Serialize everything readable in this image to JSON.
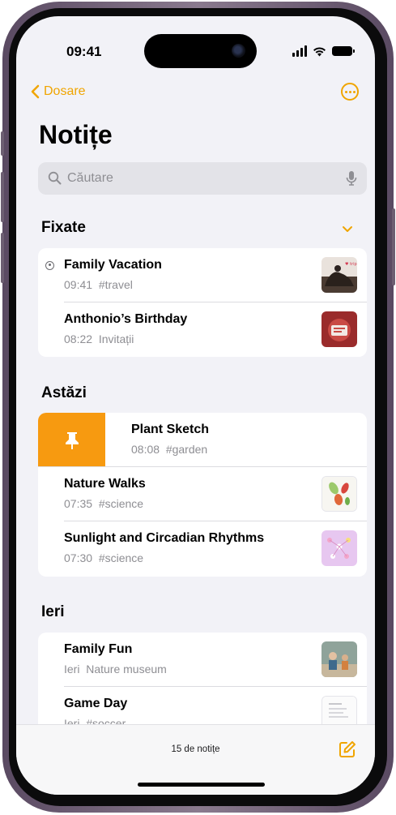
{
  "status": {
    "time": "09:41"
  },
  "nav": {
    "back_label": "Dosare"
  },
  "page": {
    "title": "Notițe"
  },
  "search": {
    "placeholder": "Căutare"
  },
  "sections": {
    "pinned": {
      "title": "Fixate"
    },
    "today": {
      "title": "Astăzi"
    },
    "yesterday": {
      "title": "Ieri"
    }
  },
  "pinned_notes": [
    {
      "title": "Family Vacation",
      "time": "09:41",
      "detail": "#travel",
      "shared": true,
      "thumb": "photo-vacation"
    },
    {
      "title": "Anthonio’s Birthday",
      "time": "08:22",
      "detail": "Invitații",
      "thumb": "photo-birthday"
    }
  ],
  "today_notes": [
    {
      "title": "Plant Sketch",
      "time": "08:08",
      "detail": "#garden",
      "swipe_action": "pin-icon"
    },
    {
      "title": "Nature Walks",
      "time": "07:35",
      "detail": "#science",
      "thumb": "sketch-leaves"
    },
    {
      "title": "Sunlight and Circadian Rhythms",
      "time": "07:30",
      "detail": "#science",
      "thumb": "sketch-flowers"
    }
  ],
  "yesterday_notes": [
    {
      "title": "Family Fun",
      "time": "Ieri",
      "detail": "Nature museum",
      "thumb": "photo-family"
    },
    {
      "title": "Game Day",
      "time": "Ieri",
      "detail": "#soccer",
      "thumb": "doc-gameday"
    }
  ],
  "footer": {
    "count": "15 de notițe"
  },
  "colors": {
    "accent": "#f0a500",
    "pin_action": "#f79a10",
    "background": "#f2f2f7"
  }
}
